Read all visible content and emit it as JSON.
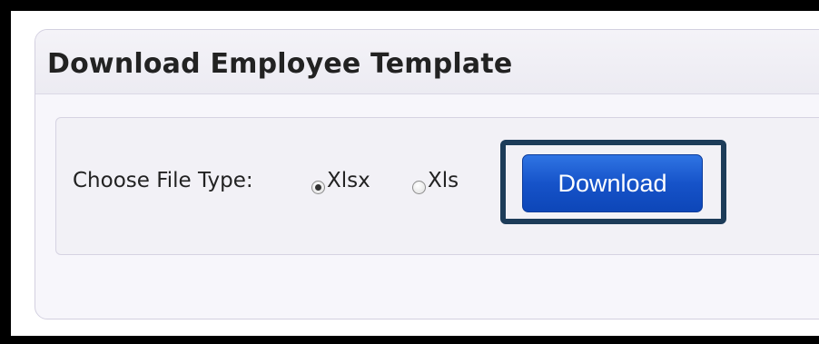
{
  "panel": {
    "title": "Download Employee Template"
  },
  "form": {
    "file_type_label": "Choose File Type:",
    "options": [
      {
        "label": "Xlsx",
        "checked": true
      },
      {
        "label": "Xls",
        "checked": false
      }
    ],
    "download_label": "Download"
  },
  "colors": {
    "button": "#1653c9",
    "highlight_border": "#1d3c59"
  },
  "icons": {
    "radio_selected": "radio-checked-icon",
    "radio_unselected": "radio-unchecked-icon"
  }
}
